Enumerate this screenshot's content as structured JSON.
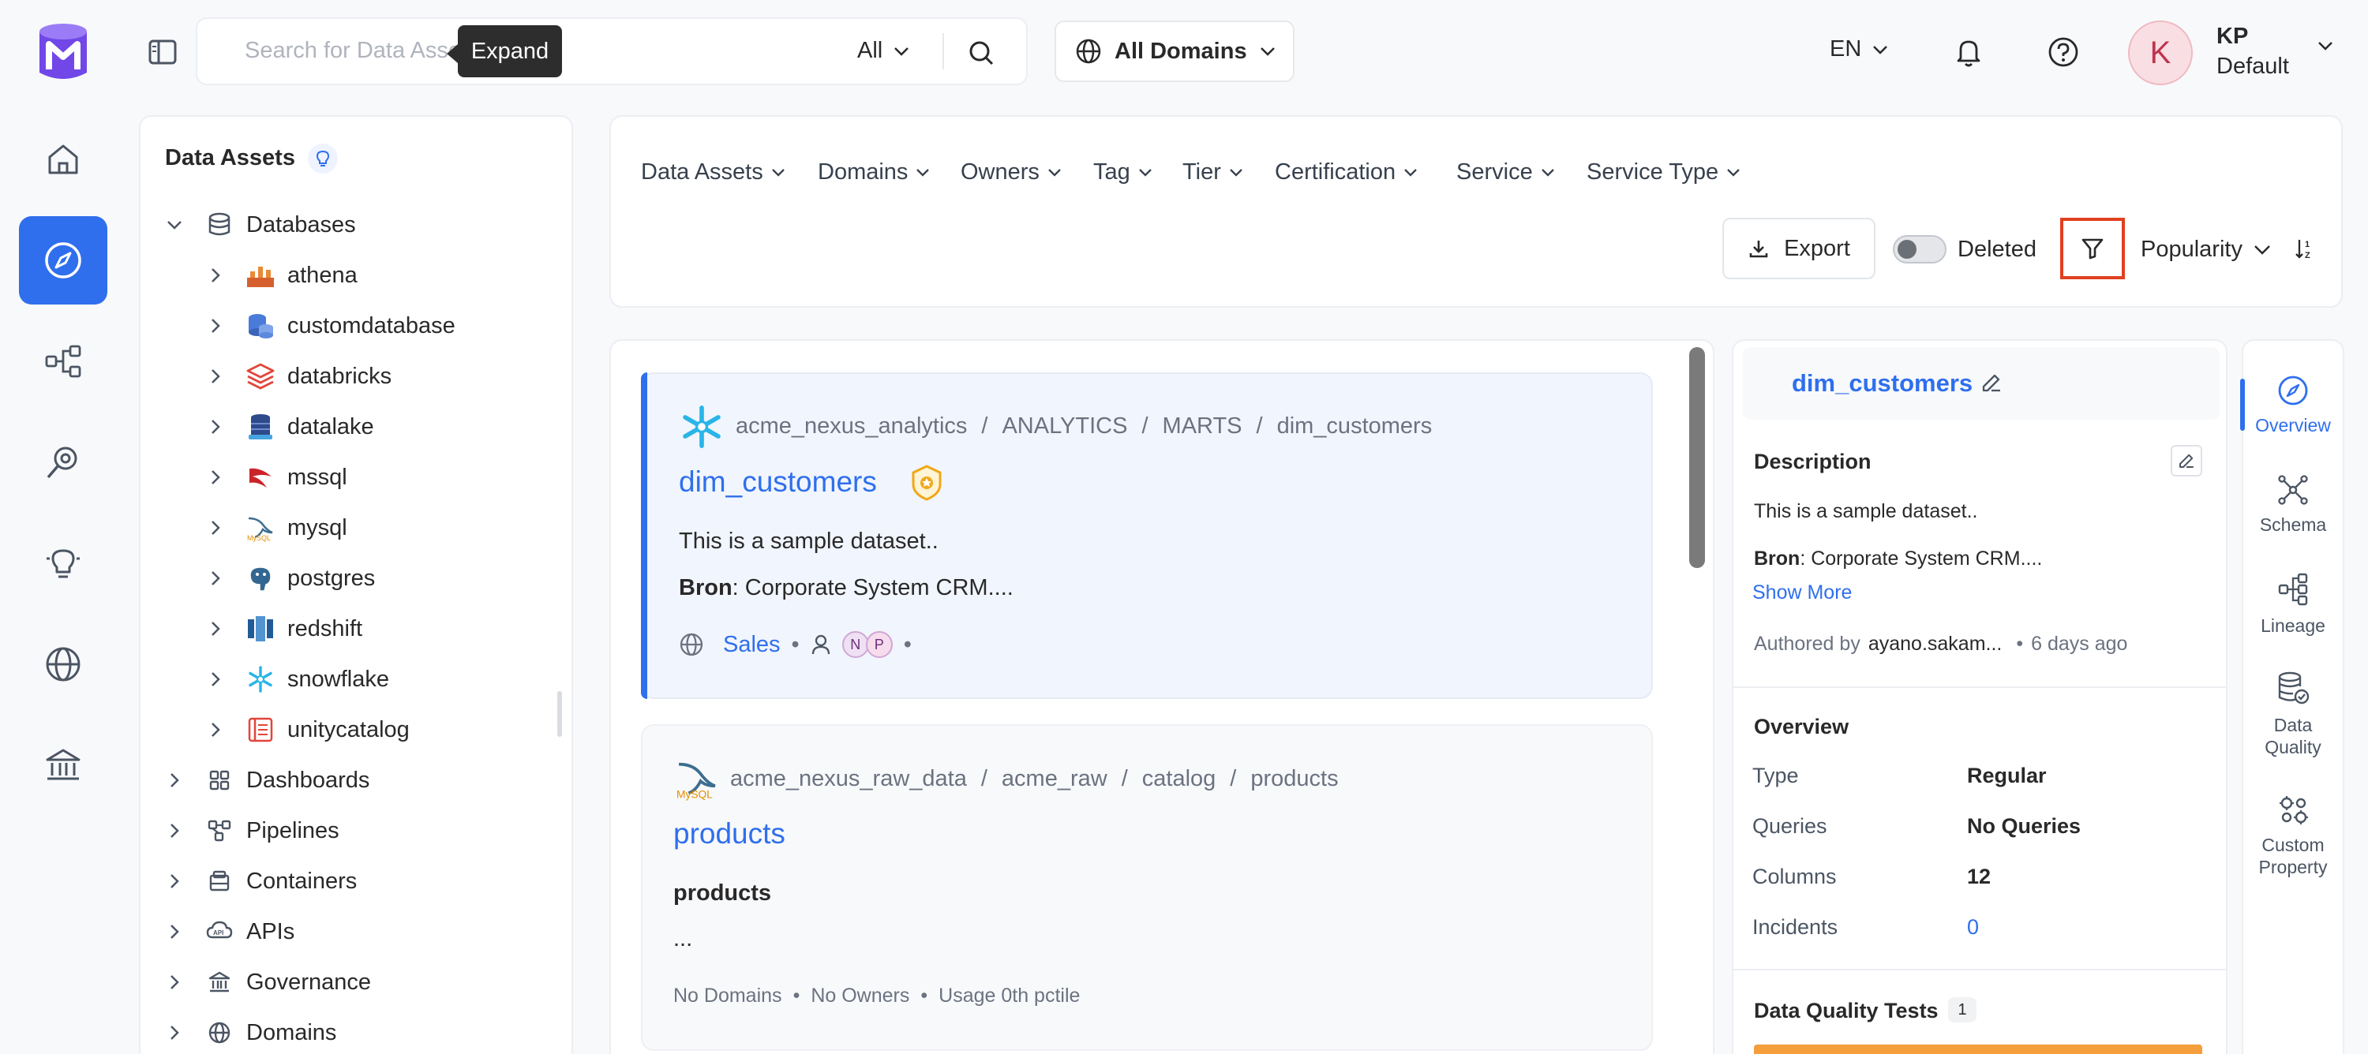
{
  "colors": {
    "primary": "#2f6fed",
    "highlight_border": "#e0401f",
    "warning_bar": "#f59e3c"
  },
  "header": {
    "search_placeholder": "Search for Data Assets",
    "tooltip": "Expand",
    "search_scope": "All",
    "domain_selector": "All Domains",
    "language": "EN",
    "user_initial": "K",
    "user_name": "KP",
    "user_role": "Default"
  },
  "nav": {
    "items": [
      "home-icon",
      "explore-icon",
      "lineage-icon",
      "observability-icon",
      "insights-icon",
      "domains-icon",
      "governance-icon"
    ],
    "active": "explore-icon"
  },
  "tree": {
    "title": "Data Assets",
    "databases_label": "Databases",
    "databases": [
      "athena",
      "customdatabase",
      "databricks",
      "datalake",
      "mssql",
      "mysql",
      "postgres",
      "redshift",
      "snowflake",
      "unitycatalog"
    ],
    "top_level": [
      "Dashboards",
      "Pipelines",
      "Containers",
      "APIs",
      "Governance",
      "Domains"
    ]
  },
  "filters": {
    "items": [
      "Data Assets",
      "Domains",
      "Owners",
      "Tag",
      "Tier",
      "Certification",
      "Service",
      "Service Type"
    ],
    "export_label": "Export",
    "deleted_label": "Deleted",
    "sort_label": "Popularity"
  },
  "results": [
    {
      "breadcrumb": [
        "acme_nexus_analytics",
        "/",
        "ANALYTICS",
        "/",
        "MARTS",
        "/",
        "dim_customers"
      ],
      "title": "dim_customers",
      "description": "This is a sample dataset..",
      "source_label": "Bron",
      "source_value": ": Corporate System CRM....",
      "domain": "Sales",
      "owners": [
        "N",
        "P"
      ]
    },
    {
      "breadcrumb": [
        "acme_nexus_raw_data",
        "/",
        "acme_raw",
        "/",
        "catalog",
        "/",
        "products"
      ],
      "title": "products",
      "description_bold": "products",
      "description_more": "...",
      "meta": [
        "No Domains",
        "•",
        "No Owners",
        "•",
        "Usage 0th pctile"
      ]
    }
  ],
  "detail": {
    "title": "dim_customers",
    "description_heading": "Description",
    "description": "This is a sample dataset..",
    "source_label": "Bron",
    "source_value": ": Corporate System CRM....",
    "show_more": "Show More",
    "authored_by": "Authored by",
    "author": "ayano.sakam...",
    "dot": "•",
    "updated": "6 days ago",
    "overview_heading": "Overview",
    "overview": [
      {
        "label": "Type",
        "value": "Regular"
      },
      {
        "label": "Queries",
        "value": "No Queries"
      },
      {
        "label": "Columns",
        "value": "12"
      },
      {
        "label": "Incidents",
        "value": "0"
      }
    ],
    "dq_heading": "Data Quality Tests",
    "dq_count": "1"
  },
  "right_tabs": [
    "Overview",
    "Schema",
    "Lineage",
    "Data Quality",
    "Custom Property"
  ]
}
